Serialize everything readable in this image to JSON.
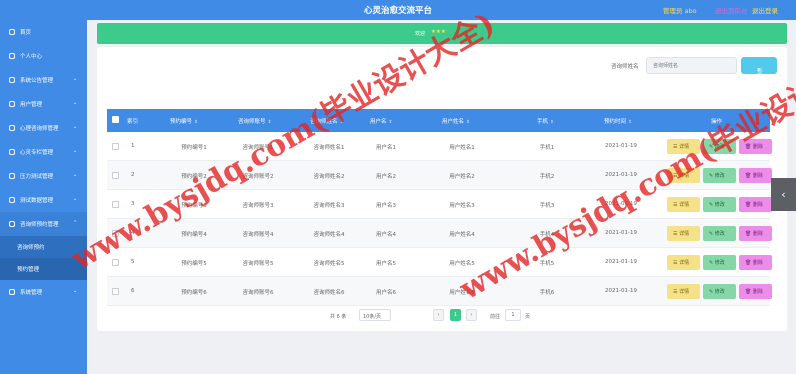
{
  "header": {
    "title": "心灵治愈交流平台",
    "user": "管理员 abo",
    "link1": "退出到前台",
    "link2": "退出登录"
  },
  "sidebar": {
    "items": [
      {
        "label": "首页"
      },
      {
        "label": "个人中心"
      },
      {
        "label": "系统公告管理",
        "arrow": "⌄"
      },
      {
        "label": "用户管理",
        "arrow": "⌄"
      },
      {
        "label": "心理咨询师管理",
        "arrow": "⌄"
      },
      {
        "label": "心灵专栏管理",
        "arrow": "⌄"
      },
      {
        "label": "压力测试管理",
        "arrow": "⌄"
      },
      {
        "label": "测试数据管理",
        "arrow": "⌄"
      },
      {
        "label": "咨询师预约管理",
        "arrow": "⌃"
      },
      {
        "label": "系统管理",
        "arrow": "⌄"
      }
    ],
    "submenu": [
      {
        "label": "咨询师预约"
      },
      {
        "label": "预约管理"
      }
    ]
  },
  "banner": {
    "text": "欢迎",
    "stars": "★★★"
  },
  "search": {
    "label": "咨询师姓名",
    "placeholder": "咨询师姓名",
    "button": "查询",
    "icon": "search-icon"
  },
  "table": {
    "columns": [
      "索引",
      "预约编号",
      "咨询师账号",
      "咨询师姓名",
      "用户名",
      "用户姓名",
      "手机",
      "预约时间",
      "操作"
    ],
    "sort_mark": "⇕",
    "rows": [
      {
        "index": "1",
        "no": "预约编号1",
        "account": "咨询师账号1",
        "name": "咨询师姓名1",
        "user": "用户名1",
        "uname": "用户姓名1",
        "phone": "手机1",
        "time": "2021-01-19"
      },
      {
        "index": "2",
        "no": "预约编号2",
        "account": "咨询师账号2",
        "name": "咨询师姓名2",
        "user": "用户名2",
        "uname": "用户姓名2",
        "phone": "手机2",
        "time": "2021-01-19"
      },
      {
        "index": "3",
        "no": "预约编号3",
        "account": "咨询师账号3",
        "name": "咨询师姓名3",
        "user": "用户名3",
        "uname": "用户姓名3",
        "phone": "手机3",
        "time": "2021-01-19"
      },
      {
        "index": "4",
        "no": "预约编号4",
        "account": "咨询师账号4",
        "name": "咨询师姓名4",
        "user": "用户名4",
        "uname": "用户姓名4",
        "phone": "手机4",
        "time": "2021-01-19"
      },
      {
        "index": "5",
        "no": "预约编号5",
        "account": "咨询师账号5",
        "name": "咨询师姓名5",
        "user": "用户名5",
        "uname": "用户姓名5",
        "phone": "手机5",
        "time": "2021-01-19"
      },
      {
        "index": "6",
        "no": "预约编号6",
        "account": "咨询师账号6",
        "name": "咨询师姓名6",
        "user": "用户名6",
        "uname": "用户姓名6",
        "phone": "手机6",
        "time": "2021-01-19"
      }
    ],
    "actions": {
      "detail": "☰ 详情",
      "edit": "✎ 修改",
      "delete": "🗑 删除"
    }
  },
  "pagination": {
    "total": "共 6 条",
    "page_size": "10条/页",
    "prev": "‹",
    "current": "1",
    "next": "›",
    "goto_label": "前往",
    "goto_value": "1",
    "page_suffix": "页"
  },
  "floating": {
    "arrow": "‹"
  },
  "watermark": {
    "text": "www.bysjdq.com(毕业设计大全)",
    "color": "#e22626"
  }
}
